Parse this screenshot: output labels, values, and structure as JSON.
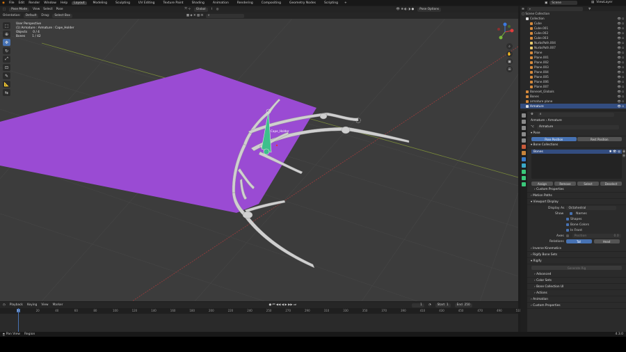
{
  "menu": {
    "items": [
      "File",
      "Edit",
      "Render",
      "Window",
      "Help"
    ],
    "workspaces": [
      "Layout",
      "Modeling",
      "Sculpting",
      "UV Editing",
      "Texture Paint",
      "Shading",
      "Animation",
      "Rendering",
      "Compositing",
      "Geometry Nodes",
      "Scripting"
    ],
    "active_workspace": "Layout",
    "scene": "Scene",
    "view_layer": "ViewLayer"
  },
  "header": {
    "mode": "Pose Mode",
    "menus": [
      "View",
      "Select",
      "Pose"
    ],
    "pivot": "Global",
    "options": "Pose Options",
    "orientation_label": "Orientation:",
    "orientation_value": "Default",
    "drag_label": "Drag:",
    "drag_value": "Select Box"
  },
  "viewport": {
    "perspective": "User Perspective",
    "object_info": "(1) Armature : Armature : Cape_Holder",
    "objects_label": "Objects",
    "objects_value": "0 / 4",
    "bones_label": "Bones",
    "bones_value": "1 / 42",
    "bone_label": "Cape_Holder",
    "plane_color": "#9a4bd3",
    "bone_color": "#cfcfcf",
    "selected_bone_color": "#3dbf8c"
  },
  "timeline": {
    "menus": [
      "Playback",
      "Keying",
      "View",
      "Marker"
    ],
    "current_frame": "1",
    "start_label": "Start",
    "start_value": "1",
    "end_label": "End",
    "end_value": "250",
    "ticks": [
      "0",
      "20",
      "40",
      "60",
      "80",
      "100",
      "120",
      "140",
      "160",
      "180",
      "200",
      "220",
      "240",
      "250",
      "270",
      "290",
      "310",
      "330",
      "350",
      "370",
      "390",
      "410",
      "430",
      "450",
      "470",
      "490",
      "510",
      "530",
      "550",
      "570",
      "590"
    ]
  },
  "status": {
    "left": "Pan View",
    "left2": "Region",
    "version": "4.3.0"
  },
  "outliner": {
    "title": "Scene Collection",
    "rows": [
      {
        "label": "Collection",
        "indent": 1,
        "color": "#e0e0e0"
      },
      {
        "label": "Cube",
        "indent": 2,
        "color": "#d68a3c"
      },
      {
        "label": "Cube.001",
        "indent": 2,
        "color": "#d68a3c"
      },
      {
        "label": "Cube.002",
        "indent": 2,
        "color": "#d68a3c"
      },
      {
        "label": "Cube.003",
        "indent": 2,
        "color": "#d68a3c"
      },
      {
        "label": "NurbsPath.004",
        "indent": 2,
        "color": "#e8c86a"
      },
      {
        "label": "NurbsPath.007",
        "indent": 2,
        "color": "#e8c86a"
      },
      {
        "label": "Plane",
        "indent": 2,
        "color": "#d68a3c"
      },
      {
        "label": "Plane.001",
        "indent": 2,
        "color": "#d68a3c"
      },
      {
        "label": "Plane.002",
        "indent": 2,
        "color": "#d68a3c"
      },
      {
        "label": "Plane.003",
        "indent": 2,
        "color": "#d68a3c"
      },
      {
        "label": "Plane.004",
        "indent": 2,
        "color": "#d68a3c"
      },
      {
        "label": "Plane.005",
        "indent": 2,
        "color": "#d68a3c"
      },
      {
        "label": "Plane.006",
        "indent": 2,
        "color": "#d68a3c"
      },
      {
        "label": "Plane.007",
        "indent": 2,
        "color": "#d68a3c"
      },
      {
        "label": "Boneset_Globals",
        "indent": 1,
        "color": "#d68a3c"
      },
      {
        "label": "Bones",
        "indent": 1,
        "color": "#d68a3c"
      },
      {
        "label": "armature plane",
        "indent": 1,
        "color": "#d68a3c"
      },
      {
        "label": "Armature",
        "indent": 1,
        "color": "#e0e0e0",
        "selected": true
      }
    ]
  },
  "properties": {
    "breadcrumb": "Armature",
    "breadcrumb2": "Armature",
    "name": "Armature",
    "pose_section": "Pose",
    "pose_position": "Pose Position",
    "rest_position": "Rest Position",
    "bone_collections": "Bone Collections",
    "collection_item": "Bones",
    "assign": "Assign",
    "remove": "Remove",
    "select": "Select",
    "deselect": "Deselect",
    "custom_properties_sub": "Custom Properties",
    "motion_paths": "Motion Paths",
    "viewport_display": "Viewport Display",
    "display_as_label": "Display As",
    "display_as_value": "Octahedral",
    "show_label": "Show",
    "show_names": "Names",
    "show_shapes": "Shapes",
    "show_bone_colors": "Bone Colors",
    "show_in_front": "In Front",
    "axes_label": "Axes",
    "position_label": "Position",
    "position_value": "0.0",
    "relations_label": "Relations",
    "tail": "Tail",
    "head": "Head",
    "inverse_kinematics": "Inverse Kinematics",
    "rigify_bone_sets": "Rigify Bone Sets",
    "rigify": "Rigify",
    "generate": "Generate Rig",
    "advanced": "Advanced",
    "color_sets": "Color Sets",
    "bone_collection_ui": "Bone Collection UI",
    "actions": "Actions",
    "animation": "Animation",
    "custom_properties": "Custom Properties"
  }
}
